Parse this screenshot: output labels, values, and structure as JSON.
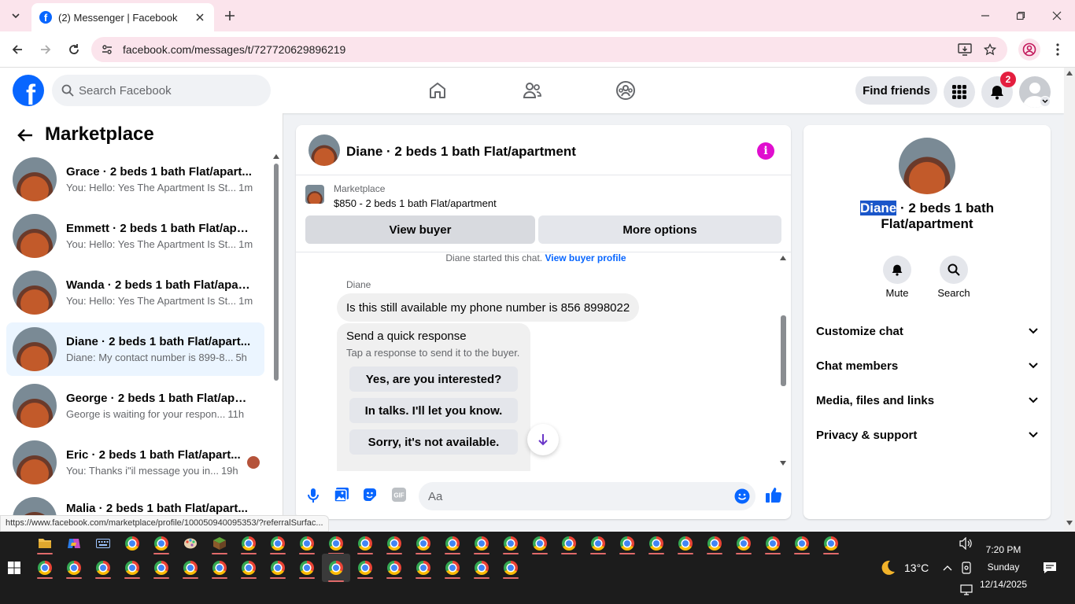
{
  "browser": {
    "tab_title": "(2) Messenger | Facebook",
    "url": "facebook.com/messages/t/727720629896219",
    "status_url": "https://www.facebook.com/marketplace/profile/100050940095353/?referralSurfac..."
  },
  "fb": {
    "search_placeholder": "Search Facebook",
    "find_friends": "Find friends",
    "notif_count": "2",
    "brand_color": "#0866ff"
  },
  "sidebar": {
    "title": "Marketplace",
    "conversations": [
      {
        "name": "Grace · 2 beds 1 bath Flat/apart...",
        "preview": "You: Hello: Yes The Apartment Is St...",
        "time": "1m"
      },
      {
        "name": "Emmett · 2 beds 1 bath Flat/apar...",
        "preview": "You: Hello: Yes The Apartment Is St...",
        "time": "1m"
      },
      {
        "name": "Wanda · 2 beds 1 bath Flat/apart...",
        "preview": "You: Hello: Yes The Apartment Is St...",
        "time": "1m"
      },
      {
        "name": "Diane · 2 beds 1 bath Flat/apart...",
        "preview": "Diane: My contact number is 899-8...",
        "time": "5h"
      },
      {
        "name": "George · 2 beds 1 bath Flat/apar...",
        "preview": "George is waiting for your respon...",
        "time": "11h"
      },
      {
        "name": "Eric · 2 beds 1 bath Flat/apart...",
        "preview": "You: Thanks i\"il message you in...",
        "time": "19h"
      },
      {
        "name": "Malia · 2 beds 1 bath Flat/apart...",
        "preview": "",
        "time": ""
      }
    ]
  },
  "chat": {
    "header_title": "Diane · 2 beds 1 bath Flat/apartment",
    "listing_label": "Marketplace",
    "listing_title": "$850 - 2 beds 1 bath Flat/apartment",
    "view_buyer": "View buyer",
    "more_options": "More options",
    "started_text": "Diane started this chat.",
    "view_buyer_profile": "View buyer profile",
    "sender": "Diane",
    "message": "Is this still available my phone number is 856 8998022",
    "quick_title": "Send a quick response",
    "quick_sub": "Tap a response to send it to the buyer.",
    "quick_responses": [
      "Yes, are you interested?",
      "In talks. I'll let you know.",
      "Sorry, it's not available."
    ],
    "composer_placeholder": "Aa"
  },
  "details": {
    "name_highlight": "Diane",
    "name_rest": " · 2 beds 1 bath",
    "name_line2": "Flat/apartment",
    "mute": "Mute",
    "search": "Search",
    "sections": [
      "Customize chat",
      "Chat members",
      "Media, files and links",
      "Privacy & support"
    ]
  },
  "taskbar": {
    "weather": "13°C",
    "time": "7:20 PM",
    "day": "Sunday",
    "date": "12/14/2025"
  }
}
